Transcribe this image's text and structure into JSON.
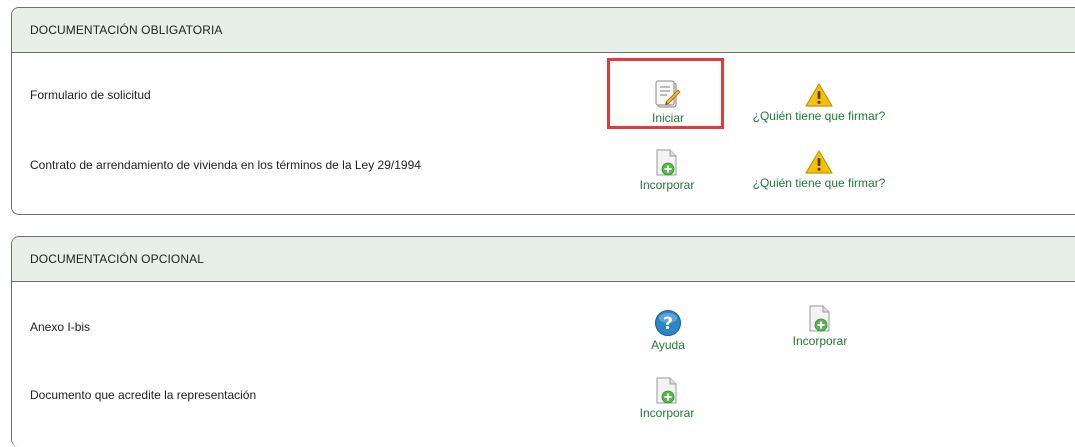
{
  "mandatory": {
    "title": "DOCUMENTACIÓN OBLIGATORIA",
    "rows": [
      {
        "label": "Formulario de solicitud",
        "action1": {
          "label": "Iniciar",
          "icon": "form-edit-icon"
        },
        "action2": {
          "label": "¿Quién tiene que firmar?",
          "icon": "warning-icon"
        }
      },
      {
        "label": "Contrato de arrendamiento de vivienda en los términos de la Ley 29/1994",
        "action1": {
          "label": "Incorporar",
          "icon": "add-document-icon"
        },
        "action2": {
          "label": "¿Quién tiene que firmar?",
          "icon": "warning-icon"
        }
      }
    ]
  },
  "optional": {
    "title": "DOCUMENTACIÓN OPCIONAL",
    "rows": [
      {
        "label": "Anexo I-bis",
        "action1": {
          "label": "Ayuda",
          "icon": "help-icon"
        },
        "action2": {
          "label": "Incorporar",
          "icon": "add-document-icon"
        }
      },
      {
        "label": "Documento que acredite la representación",
        "action1": {
          "label": "Incorporar",
          "icon": "add-document-icon"
        }
      }
    ]
  },
  "colors": {
    "header_bg": "#e6efe8",
    "link_green": "#1f7a36",
    "highlight_red": "#e03a3a",
    "warning_yellow": "#f4c20d",
    "help_blue": "#2b86c5"
  }
}
